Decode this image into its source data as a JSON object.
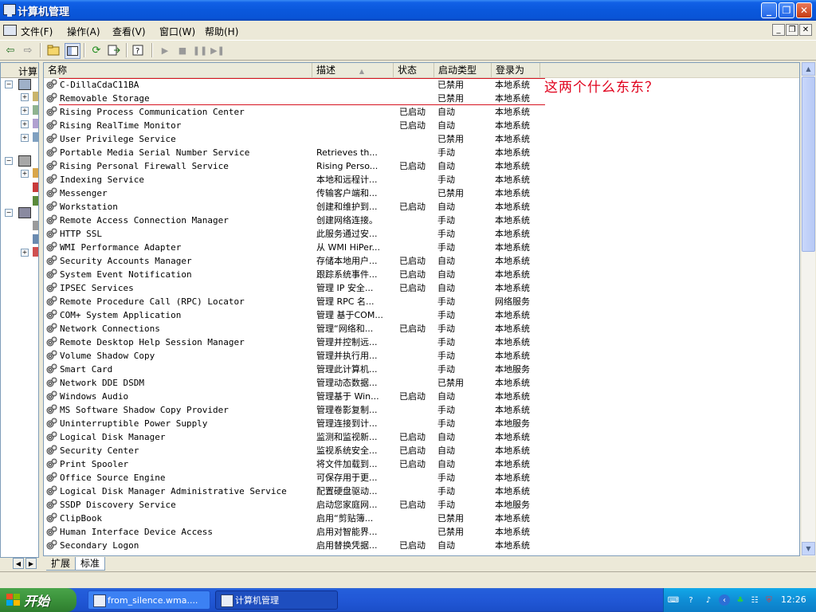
{
  "window": {
    "title": "计算机管理"
  },
  "menu": [
    "文件(F)",
    "操作(A)",
    "查看(V)",
    "窗口(W)",
    "帮助(H)"
  ],
  "tree": {
    "header": "计算"
  },
  "columns": {
    "name": "名称",
    "desc": "描述",
    "status": "状态",
    "startup": "启动类型",
    "logon": "登录为"
  },
  "services": [
    {
      "name": "C-DillaCdaC11BA",
      "desc": "",
      "status": "",
      "startup": "已禁用",
      "logon": "本地系统"
    },
    {
      "name": "Removable Storage",
      "desc": "",
      "status": "",
      "startup": "已禁用",
      "logon": "本地系统"
    },
    {
      "name": "Rising Process Communication Center",
      "desc": "",
      "status": "已启动",
      "startup": "自动",
      "logon": "本地系统"
    },
    {
      "name": "Rising RealTime Monitor",
      "desc": "",
      "status": "已启动",
      "startup": "自动",
      "logon": "本地系统"
    },
    {
      "name": "User Privilege Service",
      "desc": "",
      "status": "",
      "startup": "已禁用",
      "logon": "本地系统"
    },
    {
      "name": "Portable Media Serial Number Service",
      "desc": "Retrieves th...",
      "status": "",
      "startup": "手动",
      "logon": "本地系统"
    },
    {
      "name": "Rising Personal Firewall Service",
      "desc": "Rising Perso...",
      "status": "已启动",
      "startup": "自动",
      "logon": "本地系统"
    },
    {
      "name": "Indexing Service",
      "desc": "本地和远程计...",
      "status": "",
      "startup": "手动",
      "logon": "本地系统"
    },
    {
      "name": "Messenger",
      "desc": "传输客户端和...",
      "status": "",
      "startup": "已禁用",
      "logon": "本地系统"
    },
    {
      "name": "Workstation",
      "desc": "创建和维护到...",
      "status": "已启动",
      "startup": "自动",
      "logon": "本地系统"
    },
    {
      "name": "Remote Access Connection Manager",
      "desc": "创建网络连接。",
      "status": "",
      "startup": "手动",
      "logon": "本地系统"
    },
    {
      "name": "HTTP SSL",
      "desc": "此服务通过安...",
      "status": "",
      "startup": "手动",
      "logon": "本地系统"
    },
    {
      "name": "WMI Performance Adapter",
      "desc": "从 WMI HiPer...",
      "status": "",
      "startup": "手动",
      "logon": "本地系统"
    },
    {
      "name": "Security Accounts Manager",
      "desc": "存储本地用户...",
      "status": "已启动",
      "startup": "自动",
      "logon": "本地系统"
    },
    {
      "name": "System Event Notification",
      "desc": "跟踪系统事件...",
      "status": "已启动",
      "startup": "自动",
      "logon": "本地系统"
    },
    {
      "name": "IPSEC Services",
      "desc": "管理 IP 安全...",
      "status": "已启动",
      "startup": "自动",
      "logon": "本地系统"
    },
    {
      "name": "Remote Procedure Call (RPC) Locator",
      "desc": "管理 RPC 名...",
      "status": "",
      "startup": "手动",
      "logon": "网络服务"
    },
    {
      "name": "COM+ System Application",
      "desc": "管理 基于COM...",
      "status": "",
      "startup": "手动",
      "logon": "本地系统"
    },
    {
      "name": "Network Connections",
      "desc": "管理“网络和...",
      "status": "已启动",
      "startup": "手动",
      "logon": "本地系统"
    },
    {
      "name": "Remote Desktop Help Session Manager",
      "desc": "管理并控制远...",
      "status": "",
      "startup": "手动",
      "logon": "本地系统"
    },
    {
      "name": "Volume Shadow Copy",
      "desc": "管理并执行用...",
      "status": "",
      "startup": "手动",
      "logon": "本地系统"
    },
    {
      "name": "Smart Card",
      "desc": "管理此计算机...",
      "status": "",
      "startup": "手动",
      "logon": "本地服务"
    },
    {
      "name": "Network DDE DSDM",
      "desc": "管理动态数据...",
      "status": "",
      "startup": "已禁用",
      "logon": "本地系统"
    },
    {
      "name": "Windows Audio",
      "desc": "管理基于 Win...",
      "status": "已启动",
      "startup": "自动",
      "logon": "本地系统"
    },
    {
      "name": "MS Software Shadow Copy Provider",
      "desc": "管理卷影复制...",
      "status": "",
      "startup": "手动",
      "logon": "本地系统"
    },
    {
      "name": "Uninterruptible Power Supply",
      "desc": "管理连接到计...",
      "status": "",
      "startup": "手动",
      "logon": "本地服务"
    },
    {
      "name": "Logical Disk Manager",
      "desc": "监测和监视新...",
      "status": "已启动",
      "startup": "自动",
      "logon": "本地系统"
    },
    {
      "name": "Security Center",
      "desc": "监视系统安全...",
      "status": "已启动",
      "startup": "自动",
      "logon": "本地系统"
    },
    {
      "name": "Print Spooler",
      "desc": "将文件加载到...",
      "status": "已启动",
      "startup": "自动",
      "logon": "本地系统"
    },
    {
      "name": "Office Source Engine",
      "desc": "可保存用于更...",
      "status": "",
      "startup": "手动",
      "logon": "本地系统"
    },
    {
      "name": "Logical Disk Manager Administrative Service",
      "desc": "配置硬盘驱动...",
      "status": "",
      "startup": "手动",
      "logon": "本地系统"
    },
    {
      "name": "SSDP Discovery Service",
      "desc": "启动您家庭网...",
      "status": "已启动",
      "startup": "手动",
      "logon": "本地服务"
    },
    {
      "name": "ClipBook",
      "desc": "启用“剪贴簿...",
      "status": "",
      "startup": "已禁用",
      "logon": "本地系统"
    },
    {
      "name": "Human Interface Device Access",
      "desc": "启用对智能界...",
      "status": "",
      "startup": "已禁用",
      "logon": "本地系统"
    },
    {
      "name": "Secondary Logon",
      "desc": "启用替换凭据...",
      "status": "已启动",
      "startup": "自动",
      "logon": "本地系统"
    }
  ],
  "annotation": "这两个什么东东？",
  "tabs": {
    "extended": "扩展",
    "standard": "标准"
  },
  "taskbar": {
    "start": "开始",
    "tasks": [
      "from_silence.wma....",
      "计算机管理"
    ],
    "clock": "12:26"
  },
  "colors": {
    "titlebar": "#0a58dc",
    "annotation": "#e0001b",
    "taskbar": "#245edb",
    "start": "#3b923b"
  }
}
